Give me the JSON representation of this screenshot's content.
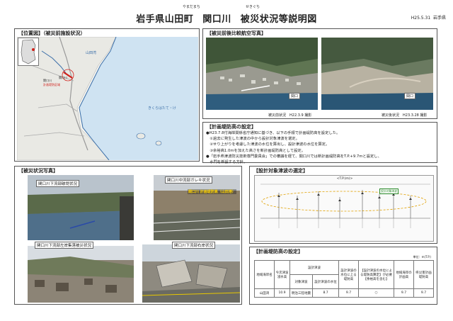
{
  "header": {
    "ruby_town": "やまだまち",
    "ruby_river": "せきぐち",
    "pref_town": "岩手県山田町",
    "river": "関口川",
    "subject": "被災状況等説明図",
    "date": "H25.5.31",
    "author": "岩手県"
  },
  "panels": {
    "location": {
      "title": "【位置図】（被災前施設状況）",
      "map_labels": [
        "山田湾",
        "きくらはたて・け",
        "関口川"
      ],
      "legend": [
        "関口川",
        "計画堤防区域"
      ]
    },
    "aerial": {
      "title": "【被災前後比較航空写真】",
      "before_caption": "被災前状況　H22.3.9 撮影",
      "after_caption": "被災後状況　H23.3.28 撮影",
      "marker": "関口"
    },
    "plan": {
      "title": "【計画堤防高の設定】",
      "lines": [
        "●H23.7.8付海岸関係省庁通知に基づき、以下の手順で計画堤防高を設定した。",
        "　①過去に発生した津波の中から設計対象津波を選定。",
        "　②せり上がりを考慮した津波の水位を算出し、設計津波の水位を算定。",
        "　③余裕高1.0mを加えた高さを新計画堤防高として設定。",
        "●「岩手県津波防災技術専門委員会」での審議を経て、関口川では新計画堤防高をT.P.+9.7mと設定し、",
        "　水門を新設する方針。"
      ]
    },
    "damage": {
      "title": "【被災状況写真】",
      "photos": [
        "関口川下流部破堤状況",
        "関口川中流部ガレキ状況",
        "関口川下流部左岸集落被災状況",
        "関口川下流部右岸状況"
      ],
      "overlay": "関口川 計画堤防高（山田港）"
    },
    "design": {
      "title": "【設計対象津波の選定】",
      "top_label": "<T.P.(m)>",
      "legend_box": "設計対象津波"
    },
    "table": {
      "title": "【計画堤防高の設定】",
      "unit": "単位：m(T.P.)",
      "headers": [
        "地域海岸名",
        "今次津波浸水高",
        "設計津波",
        "",
        "設計津波の水位に上る堤防高",
        "【設計津波の水位による堤防高算定】が必要【余裕高を含む】",
        "地域海岸の計画高",
        "県災害計画堤防高"
      ],
      "subheaders": [
        "対象津波",
        "設計津波の水位"
      ],
      "row": [
        "山田湾",
        "10.9",
        "明治三陸地震",
        "8.7",
        "9.7",
        "○",
        "9.7",
        "9.7"
      ]
    }
  }
}
